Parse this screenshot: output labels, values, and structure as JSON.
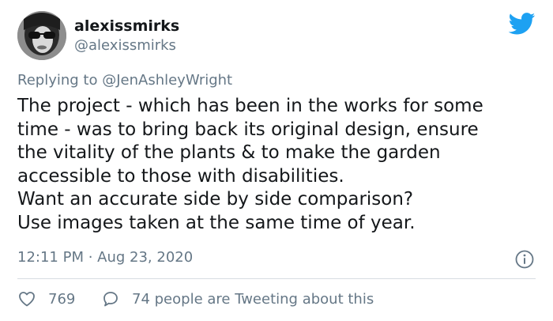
{
  "author": {
    "display_name": "alexissmirks",
    "handle": "@alexissmirks"
  },
  "reply_context": {
    "prefix": "Replying to",
    "mention": "@JenAshleyWright"
  },
  "tweet": {
    "lines": [
      "The project - which has been in the works for some",
      "time - was to bring back its original design, ensure",
      "the vitality of the plants & to make the garden",
      "accessible to those with disabilities.",
      "Want an accurate side by side comparison?",
      "Use images taken at the same time of year."
    ],
    "timestamp": "12:11 PM · Aug 23, 2020"
  },
  "actions": {
    "likes": "769",
    "tweeting_about": "74 people are Tweeting about this"
  },
  "colors": {
    "twitter_blue": "#1da1f2",
    "secondary_text": "#657786",
    "primary_text": "#14171a",
    "divider": "#d7dde2"
  },
  "icons": {
    "logo": "twitter-bird-icon",
    "info": "info-icon",
    "like": "heart-icon",
    "reply": "speech-bubble-icon"
  }
}
